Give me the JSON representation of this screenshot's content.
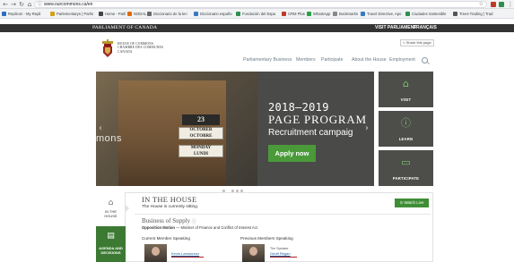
{
  "browser": {
    "url": "www.ourcommons.ca/en",
    "bookmarks": [
      {
        "label": "Replicon - My Repli",
        "color": "#2b6fbf"
      },
      {
        "label": "Parlementarys | Parlin",
        "color": "#d4a017"
      },
      {
        "label": "Home - Parli",
        "color": "#444444"
      },
      {
        "label": "NODAL",
        "color": "#e06b00"
      },
      {
        "label": "Diccionario de la len",
        "color": "#6a6a6a"
      },
      {
        "label": "Diccionario españo",
        "color": "#3a78c2"
      },
      {
        "label": "Fundación del Espa",
        "color": "#2f8f4e"
      },
      {
        "label": "CRM Plus",
        "color": "#c0392b"
      },
      {
        "label": "WhatsApp",
        "color": "#25a244"
      },
      {
        "label": "Bookmarks",
        "color": "#888888"
      },
      {
        "label": "Travel Directive, Apo",
        "color": "#3a78c2"
      },
      {
        "label": "Ciudades Sostenible",
        "color": "#2f8f4e"
      },
      {
        "label": "Trees Trading | Trad",
        "color": "#555555"
      }
    ]
  },
  "header": {
    "parliament_label": "PARLIAMENT OF CANADA",
    "visit_parliament": "VISIT PARLIAMENT",
    "language": "FRANÇAIS",
    "house_title_lines": [
      "HOUSE OF COMMONS",
      "CHAMBRE DES COMMUNES",
      "CANADA"
    ],
    "share_label": "< Share this page",
    "nav": [
      "Parliamentary Business",
      "Members",
      "Participate",
      "About the House",
      "Employment"
    ]
  },
  "hero": {
    "sign_number": "23",
    "sign_month": "OCTOBER",
    "sign_month_fr": "OCTOBRE",
    "sign_day": "MONDAY",
    "sign_day_fr": "LUNDI",
    "slide_fragment": "mons",
    "year": "2018–2019",
    "program": "PAGE PROGRAM",
    "recruit": "Recruitment campaig",
    "apply": "Apply now",
    "accent_color": "#4a9a3a"
  },
  "tiles": [
    {
      "label": "VISIT",
      "icon": "building-icon"
    },
    {
      "label": "LEARN",
      "icon": "info-icon"
    },
    {
      "label": "PARTICIPATE",
      "icon": "chat-icon"
    }
  ],
  "house": {
    "side_label_1": "IN THE",
    "side_label_2": "HOUSE",
    "agenda_label_1": "AGENDA AND",
    "agenda_label_2": "DECISIONS",
    "title": "IN THE HOUSE",
    "status": "The House is currently sitting.",
    "watch_live": "Watch Live",
    "business_title": "Business of Supply",
    "motion_label": "Opposition Motion",
    "motion_text": "— Minister of Finance and Conflict of Interest Act",
    "current_label": "Current Member Speaking",
    "previous_label": "Previous Members Speaking",
    "current_name": "Kevin Lamoureux",
    "previous_role": "The Speaker",
    "previous_name": "Geoff Regan"
  }
}
